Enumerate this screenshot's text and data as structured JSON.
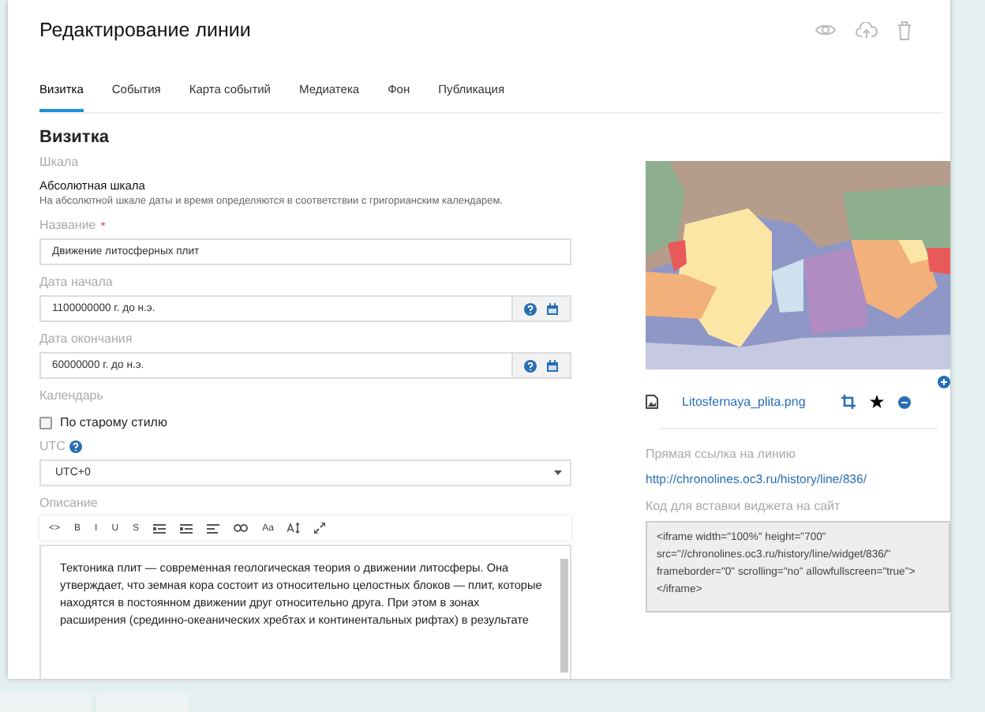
{
  "header": {
    "title": "Редактирование линии"
  },
  "tabs": [
    {
      "label": "Визитка",
      "selected": true
    },
    {
      "label": "События",
      "selected": false
    },
    {
      "label": "Карта событий",
      "selected": false
    },
    {
      "label": "Медиатека",
      "selected": false
    },
    {
      "label": "Фон",
      "selected": false
    },
    {
      "label": "Публикация",
      "selected": false
    }
  ],
  "section_title": "Визитка",
  "scale": {
    "label": "Шкала",
    "value": "Абсолютная шкала",
    "hint": "На абсолютной шкале даты и время определяются в соответствии с григорианским календарем."
  },
  "name_field": {
    "label": "Название",
    "required_mark": "*",
    "value": "Движение литосферных плит"
  },
  "date_fields": [
    {
      "label": "Дата начала",
      "value": "1100000000 г. до н.э."
    },
    {
      "label": "Дата окончания",
      "value": "60000000 г. до н.э."
    }
  ],
  "calendar": {
    "label": "Календарь",
    "option": "По старому стилю",
    "checked": false
  },
  "utc": {
    "label": "UTC",
    "value": "UTC+0"
  },
  "description": {
    "label": "Описание",
    "toolbar": [
      {
        "kind": "text",
        "text": "<>"
      },
      {
        "kind": "text",
        "text": "B"
      },
      {
        "kind": "text",
        "text": "I"
      },
      {
        "kind": "text",
        "text": "U"
      },
      {
        "kind": "text",
        "text": "S"
      },
      {
        "kind": "list"
      },
      {
        "kind": "list"
      },
      {
        "kind": "align"
      },
      {
        "kind": "link"
      },
      {
        "kind": "text",
        "text": "Aa"
      },
      {
        "kind": "height"
      },
      {
        "kind": "expand"
      }
    ],
    "text": "Тектоника плит — современная геологическая теория о движении литосферы. Она утверждает, что земная кора состоит из относительно целостных блоков — плит, которые находятся в постоянном движении друг относительно друга. При этом в зонах расширения (срединно-океанических хребтах и континентальных рифтах) в результате"
  },
  "media": {
    "file_name": "Litosfernaya_plita.png",
    "starred": true
  },
  "direct_link": {
    "label": "Прямая ссылка на линию",
    "url": "http://chronolines.oc3.ru/history/line/836/"
  },
  "embed": {
    "label": "Код для вставки виджета на сайт",
    "code": "<iframe width=\"100%\" height=\"700\" src=\"//chronolines.oc3.ru/history/line/widget/836/\" frameborder=\"0\" scrolling=\"no\" allowfullscreen=\"true\"></iframe>"
  }
}
